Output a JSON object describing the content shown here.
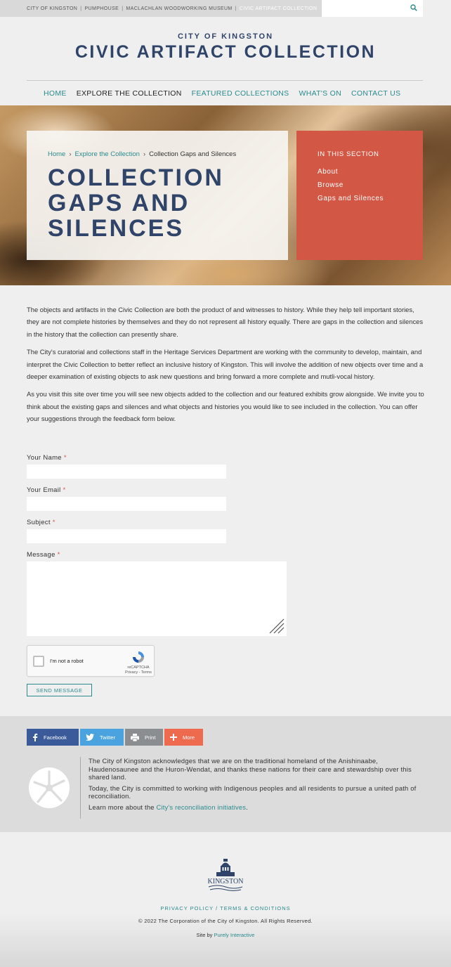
{
  "topbar": {
    "links": [
      "CITY OF KINGSTON",
      "PUMPHOUSE",
      "MACLACHLAN WOODWORKING MUSEUM"
    ],
    "current": "CIVIC ARTIFACT COLLECTION",
    "separator": "|"
  },
  "brand": {
    "subtitle": "CITY OF KINGSTON",
    "title": "CIVIC ARTIFACT COLLECTION"
  },
  "nav": {
    "items": [
      "HOME",
      "EXPLORE THE COLLECTION",
      "FEATURED COLLECTIONS",
      "WHAT'S ON",
      "CONTACT US"
    ],
    "active_index": 1
  },
  "hero": {
    "breadcrumb": [
      "Home",
      "Explore the Collection",
      "Collection Gaps and Silences"
    ],
    "title": "COLLECTION GAPS AND SILENCES",
    "section_heading": "IN THIS SECTION",
    "section_links": [
      "About",
      "Browse",
      "Gaps and Silences"
    ]
  },
  "content": {
    "paragraphs": [
      "The objects and artifacts in the Civic Collection are both the product of and witnesses to history. While they help tell important stories, they are not complete histories by themselves and they do not represent all history equally. There are gaps in the collection and silences in the history that the collection can presently share.",
      "The City's curatorial and collections staff in the Heritage Services Department are working with the community to develop, maintain, and interpret the Civic Collection to better reflect an inclusive history of Kingston. This will involve the addition of new objects over time and a deeper examination of existing objects to ask new questions and bring forward a more complete and mutli-vocal history.",
      "As you visit this site over time you will see new objects added to the collection and our featured exhibits grow alongside. We invite you to think about the existing gaps and silences and what objects and histories you would like to see included in the collection. You can offer your suggestions through the feedback form below."
    ]
  },
  "form": {
    "name_label": "Your Name",
    "email_label": "Your Email",
    "subject_label": "Subject",
    "message_label": "Message",
    "required_mark": "*",
    "captcha_label": "I'm not a robot",
    "captcha_brand": "reCAPTCHA",
    "captcha_links": "Privacy - Terms",
    "submit_label": "SEND MESSAGE"
  },
  "share": {
    "facebook": "Facebook",
    "twitter": "Twitter",
    "print": "Print",
    "more": "More"
  },
  "acknowledgement": {
    "p1": "The City of Kingston acknowledges that we are on the traditional homeland of the Anishinaabe, Haudenosaunee and the Huron-Wendat, and thanks these nations for their care and stewardship over this shared land.",
    "p2": "Today, the City is committed to working with Indigenous peoples and all residents to pursue a united path of reconciliation.",
    "p3_prefix": "Learn more about the",
    "p3_link": "City's reconciliation initiatives",
    "p3_suffix": "."
  },
  "footer": {
    "logo_text": "KINGSTON",
    "legal": "PRIVACY POLICY / TERMS & CONDITIONS",
    "copyright": "© 2022 The Corporation of the City of Kingston. All Rights Reserved.",
    "credit_prefix": "Site by",
    "credit_link": "Purely Interactive"
  },
  "colors": {
    "navy": "#2f4468",
    "teal": "#2a8a8e",
    "coral": "#d25745"
  }
}
